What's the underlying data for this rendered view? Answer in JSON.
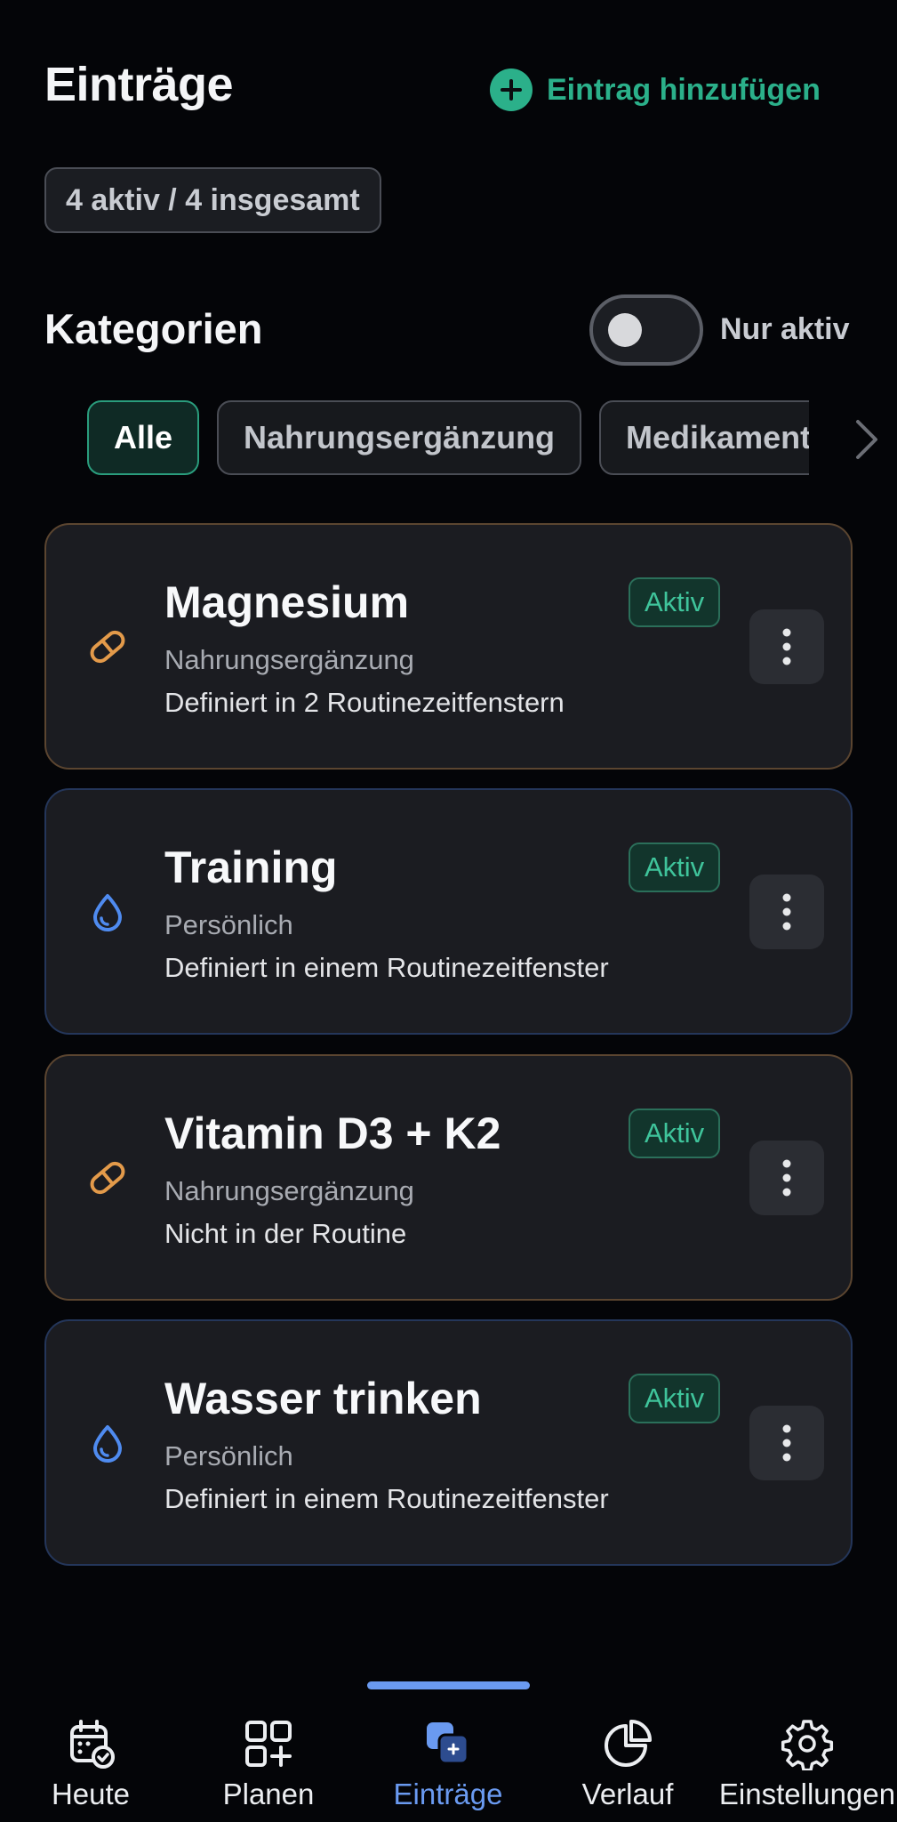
{
  "header": {
    "title": "Einträge",
    "add_label": "Eintrag hinzufügen",
    "count_label": "4 aktiv / 4 insgesamt"
  },
  "categories_section": {
    "title": "Kategorien",
    "toggle_label": "Nur aktiv",
    "toggle_on": false,
    "chips": [
      {
        "label": "Alle",
        "active": true
      },
      {
        "label": "Nahrungsergänzung",
        "active": false
      },
      {
        "label": "Medikament",
        "active": false
      }
    ]
  },
  "entries": [
    {
      "name": "Magnesium",
      "category": "Nahrungsergänzung",
      "routine": "Definiert in 2 Routinezeitfenstern",
      "status": "Aktiv",
      "icon": "pill-icon",
      "color": "#e39a4a"
    },
    {
      "name": "Training",
      "category": "Persönlich",
      "routine": "Definiert in einem Routinezeitfenster",
      "status": "Aktiv",
      "icon": "droplet-icon",
      "color": "#4f8bf0"
    },
    {
      "name": "Vitamin D3 + K2",
      "category": "Nahrungsergänzung",
      "routine": "Nicht in der Routine",
      "status": "Aktiv",
      "icon": "pill-icon",
      "color": "#e39a4a"
    },
    {
      "name": "Wasser trinken",
      "category": "Persönlich",
      "routine": "Definiert in einem Routinezeitfenster",
      "status": "Aktiv",
      "icon": "droplet-icon",
      "color": "#4f8bf0"
    }
  ],
  "bottom_nav": {
    "items": [
      {
        "label": "Heute",
        "icon": "calendar-check-icon",
        "active": false
      },
      {
        "label": "Planen",
        "icon": "grid-plus-icon",
        "active": false
      },
      {
        "label": "Einträge",
        "icon": "entries-icon",
        "active": true
      },
      {
        "label": "Verlauf",
        "icon": "pie-chart-icon",
        "active": false
      },
      {
        "label": "Einstellungen",
        "icon": "gear-icon",
        "active": false
      }
    ]
  },
  "colors": {
    "accent_green": "#2bb08a",
    "accent_blue": "#6a9af0",
    "background": "#040508",
    "card": "#1b1c21"
  }
}
